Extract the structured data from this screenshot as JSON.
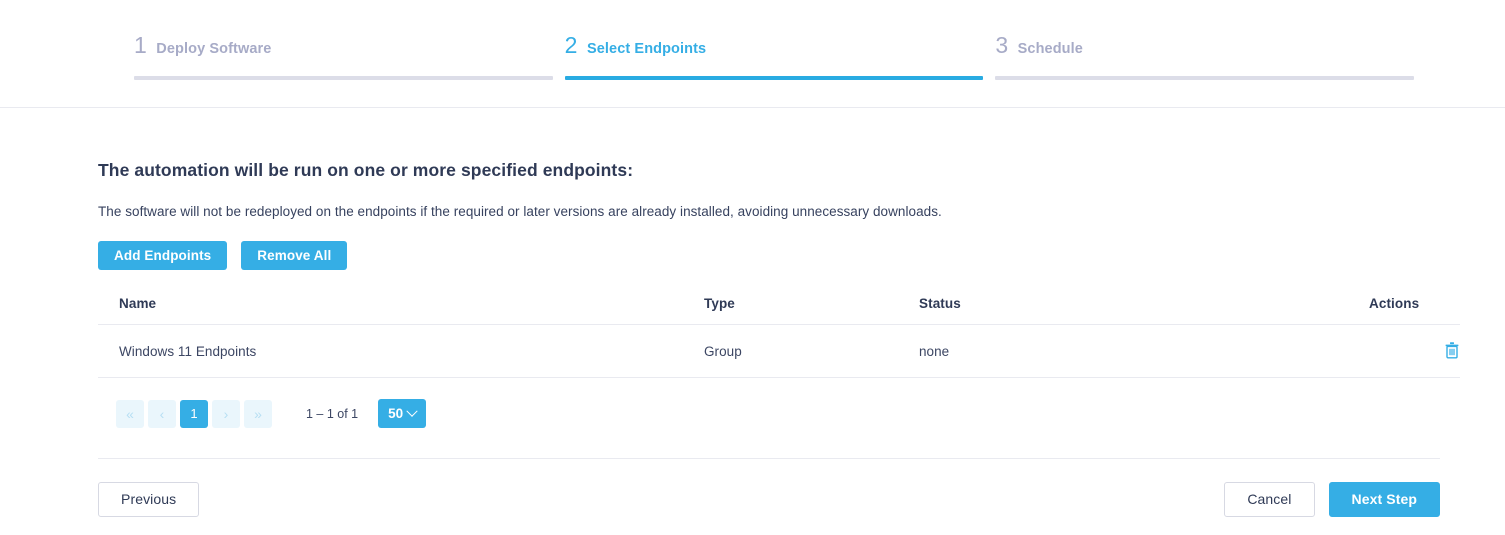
{
  "stepper": {
    "steps": [
      {
        "number": "1",
        "title": "Deploy Software",
        "state": "inactive"
      },
      {
        "number": "2",
        "title": "Select Endpoints",
        "state": "active"
      },
      {
        "number": "3",
        "title": "Schedule",
        "state": "inactive"
      }
    ]
  },
  "main": {
    "heading": "The automation will be run on one or more specified endpoints:",
    "subtext": "The software will not be redeployed on the endpoints if the required or later versions are already installed, avoiding unnecessary downloads.",
    "actions": {
      "add_endpoints_label": "Add Endpoints",
      "remove_all_label": "Remove All"
    },
    "table": {
      "columns": [
        "Name",
        "Type",
        "Status",
        "Actions"
      ],
      "rows": [
        {
          "name": "Windows 11 Endpoints",
          "type": "Group",
          "status": "none",
          "action_icon": "trash-icon"
        }
      ]
    },
    "pagination": {
      "first_label": "«",
      "prev_label": "‹",
      "current_page": "1",
      "next_label": "›",
      "last_label": "»",
      "range_text": "1 – 1 of 1",
      "page_size": "50"
    }
  },
  "footer": {
    "previous_label": "Previous",
    "cancel_label": "Cancel",
    "next_step_label": "Next Step"
  },
  "colors": {
    "accent": "#35aee5",
    "accent_bar": "#29abe2",
    "inactive_step": "#a7abc7",
    "inactive_bar": "#dcdde8",
    "text": "#2f3a56",
    "border": "#e9eaf0",
    "pager_disabled_bg": "#eaf6fc",
    "pager_disabled_fg": "#b7dff3"
  }
}
